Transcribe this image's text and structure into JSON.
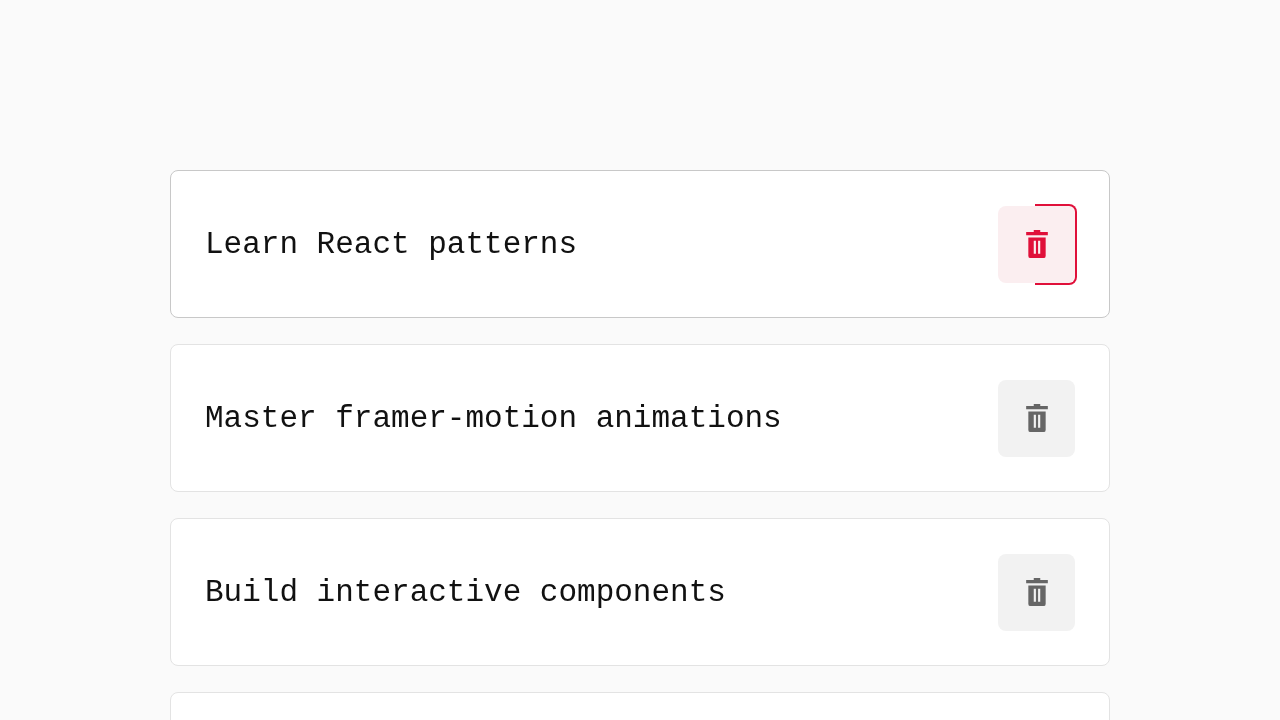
{
  "tasks": [
    {
      "kind": "full",
      "title": "Learn React patterns",
      "hovered": true
    },
    {
      "kind": "full",
      "title": "Master framer-motion animations",
      "hovered": false
    },
    {
      "kind": "full",
      "title": "Build interactive components",
      "hovered": false
    },
    {
      "kind": "edge"
    }
  ]
}
